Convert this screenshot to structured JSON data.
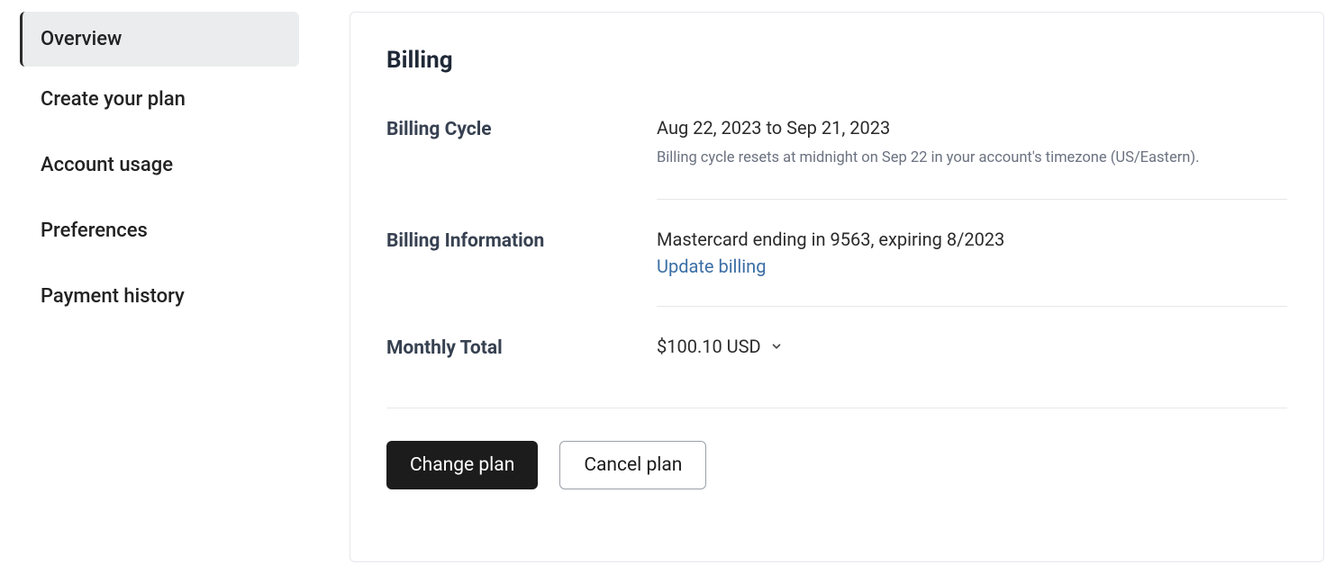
{
  "sidebar": {
    "items": [
      {
        "label": "Overview",
        "active": true
      },
      {
        "label": "Create your plan",
        "active": false
      },
      {
        "label": "Account usage",
        "active": false
      },
      {
        "label": "Preferences",
        "active": false
      },
      {
        "label": "Payment history",
        "active": false
      }
    ]
  },
  "panel": {
    "title": "Billing",
    "billing_cycle": {
      "label": "Billing Cycle",
      "range": "Aug 22, 2023 to Sep 21, 2023",
      "note": "Billing cycle resets at midnight on Sep 22 in your account's timezone (US/Eastern)."
    },
    "billing_info": {
      "label": "Billing Information",
      "card": "Mastercard ending in 9563, expiring 8/2023",
      "update_link": "Update billing"
    },
    "monthly_total": {
      "label": "Monthly Total",
      "amount": "$100.10 USD"
    },
    "buttons": {
      "change": "Change plan",
      "cancel": "Cancel plan"
    }
  }
}
